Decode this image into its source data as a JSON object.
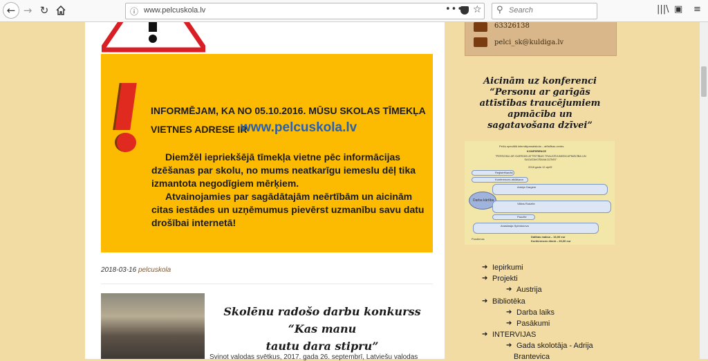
{
  "browser": {
    "url": "www.pelcuskola.lv",
    "search_placeholder": "Search",
    "more_icon": "•••"
  },
  "notice": {
    "line1": "INFORMĒJAM, KA NO 05.10.2016. MŪSU SKOLAS TĪMEKĻA",
    "line2": "VIETNES ADRESE IR",
    "url": "www.pelcuskola.lv",
    "para1_line1": "Diemžēl iepriekšējā tīmekļa vietne pēc informācijas",
    "para1_line2": "dzēšanas par skolu, no mums neatkarīgu iemeslu dēļ tika",
    "para1_line3": "izmantota negodīgiem mērķiem.",
    "para2_line1": "Atvainojamies par sagādātajām neērtībām un aicinām",
    "para2_line2": "citas iestādes un uzņēmumus pievērst uzmanību savu datu",
    "para2_line3": "drošībai internetā!"
  },
  "post_meta": {
    "date": "2018-03-16",
    "author": "pelcuskola"
  },
  "post": {
    "title_line1": "Skolēnu radošo darbu konkurss “Kas manu",
    "title_line2": "tautu dara stipru”",
    "excerpt": "Svinot valodas svētkus, 2017. gada 26. septembrī, Latviešu valodas"
  },
  "contact": {
    "phone": "63326138",
    "email": "pelci_sk@kuldiga.lv"
  },
  "sidebar": {
    "conference_title": [
      "Aicinām uz konferenci",
      "“Personu ar garīgās",
      "attīstības traucējumiem",
      "apmācība un",
      "sagatavošana dzīvei”"
    ],
    "poster": {
      "header": "Pelču speciālā internātpamatskola – attīstības centrs",
      "title": "KONFERENCE",
      "subtitle": "\"PERSONU AR GARĪGĀS ATTĪSTĪBAS TRAUCĒJUMIEM APMĀCĪBA UN SAGATAVOŠANA DZĪVEI\"",
      "date": "2018.gada 12.aprīlī",
      "circle_label": "Darba kārtība",
      "rows": [
        "Reģistrēšanās",
        "Konferences atklāšana",
        "Ardeja Gargere",
        "Vilāns Rudzīte",
        "Pauzīte",
        "Anastasija Spiridonova"
      ],
      "footer1": "Dalības maksa – 16,00 eur",
      "footer2": "Konferences dienā – 20,00 eur",
      "footer_label": "Pusdienas"
    },
    "menu": [
      {
        "label": "Iepirkumi",
        "level": 0
      },
      {
        "label": "Projekti",
        "level": 0
      },
      {
        "label": "Austrija",
        "level": 1
      },
      {
        "label": "Bibliotēka",
        "level": 0
      },
      {
        "label": "Darba laiks",
        "level": 1
      },
      {
        "label": "Pasākumi",
        "level": 1
      },
      {
        "label": "INTERVIJAS",
        "level": 0
      },
      {
        "label": "Gada skolotāja - Adrija",
        "level": 1
      },
      {
        "label": "Brantevica",
        "level": 1,
        "continuation": true
      }
    ]
  }
}
